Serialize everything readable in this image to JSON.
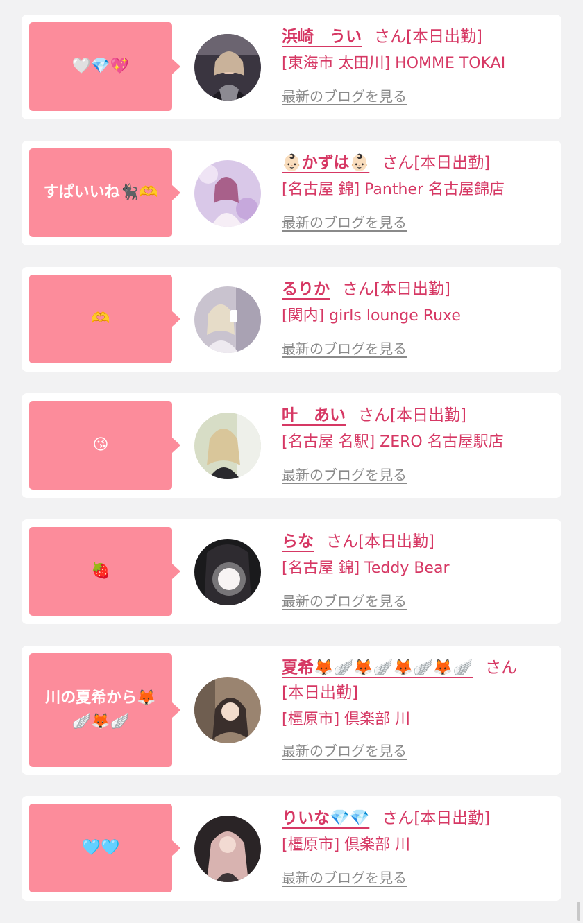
{
  "colors": {
    "bubble": "#fc8c9b",
    "accent": "#d63864",
    "link_gray": "#8a8a8a",
    "background": "#f2f2f3"
  },
  "cards": [
    {
      "message": "🤍💎💖",
      "name": "浜崎　うい",
      "suffix": "さん",
      "status": "[本日出勤]",
      "shop": "[東海市 太田川] HOMME TOKAI",
      "blog": "最新のブログを見る"
    },
    {
      "message": "すぱいいね🐈‍⬛🫶",
      "name": "👶🏻かずは👶🏻",
      "suffix": "さん",
      "status": "[本日出勤]",
      "shop": "[名古屋 錦] Panther 名古屋錦店",
      "blog": "最新のブログを見る"
    },
    {
      "message": "🫶",
      "name": "るりか",
      "suffix": "さん",
      "status": "[本日出勤]",
      "shop": "[関内] girls lounge Ruxe",
      "blog": "最新のブログを見る"
    },
    {
      "message": "😘",
      "name": "叶　あい",
      "suffix": "さん",
      "status": "[本日出勤]",
      "shop": "[名古屋 名駅] ZERO 名古屋駅店",
      "blog": "最新のブログを見る"
    },
    {
      "message": "🍓",
      "name": "らな",
      "suffix": "さん",
      "status": "[本日出勤]",
      "shop": "[名古屋 錦] Teddy Bear",
      "blog": "最新のブログを見る"
    },
    {
      "message": "川の夏希から🦊🪽🦊🪽",
      "name": "夏希🦊🪽🦊🪽🦊🪽🦊🪽",
      "suffix": "さん",
      "status": "[本日出勤]",
      "shop": "[橿原市] 倶楽部 川",
      "blog": "最新のブログを見る"
    },
    {
      "message": "🩵🩵",
      "name": "りいな💎💎",
      "suffix": "さん",
      "status": "[本日出勤]",
      "shop": "[橿原市] 倶楽部 川",
      "blog": "最新のブログを見る"
    }
  ]
}
